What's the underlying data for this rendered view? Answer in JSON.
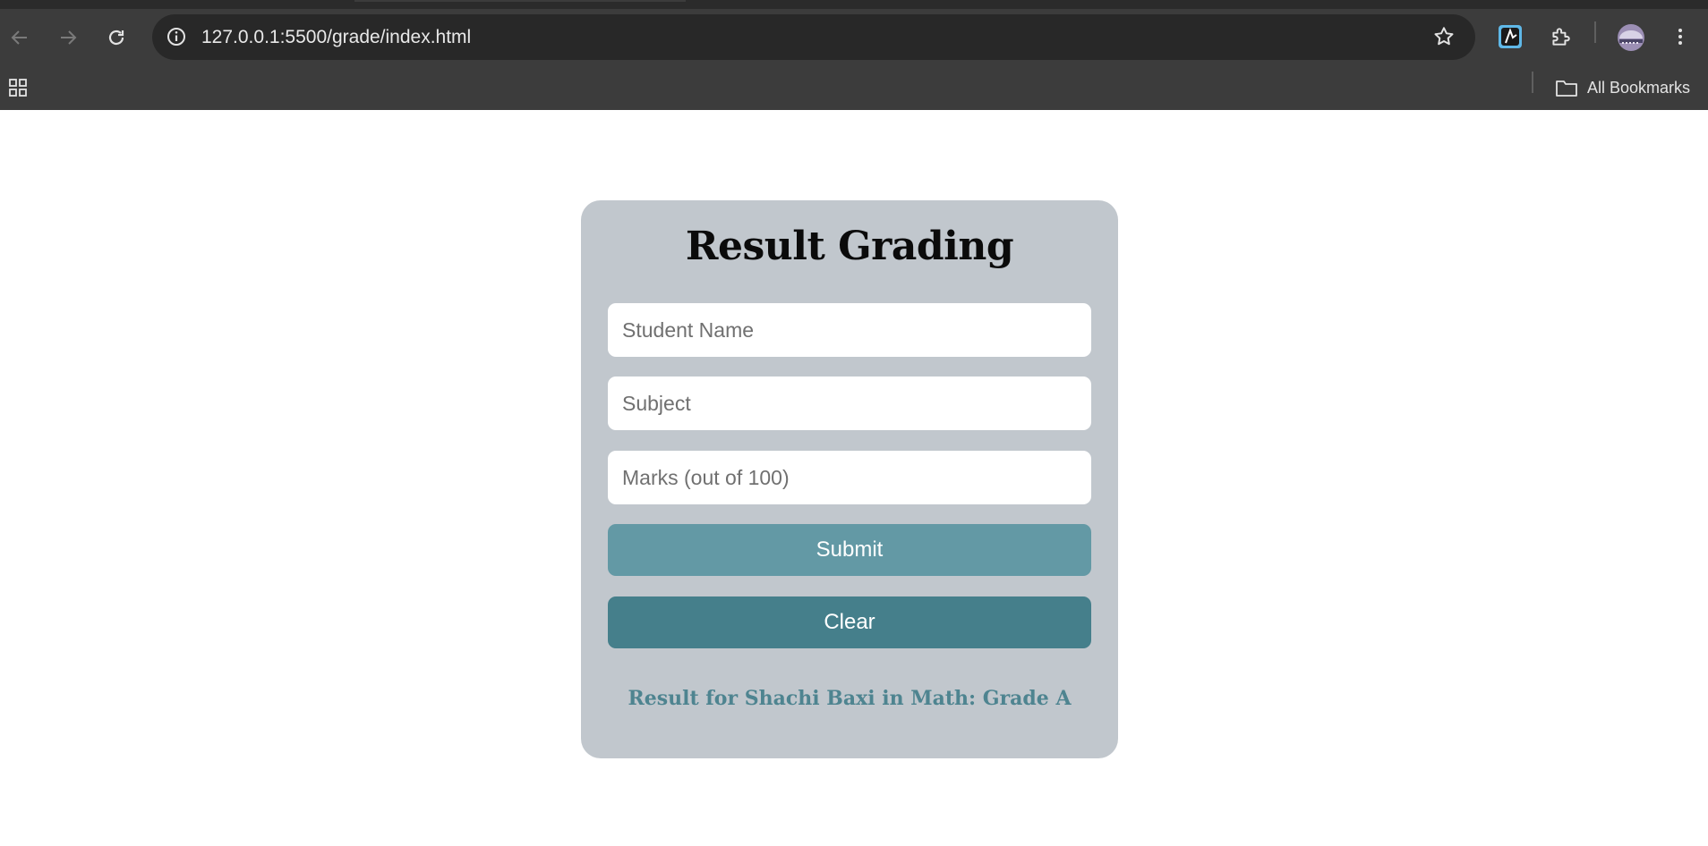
{
  "browser": {
    "url": "127.0.0.1:5500/grade/index.html",
    "bookmarks_label": "All Bookmarks",
    "chrome_color": "#3c3c3c"
  },
  "page": {
    "title": "Result Grading",
    "student_name_placeholder": "Student Name",
    "subject_placeholder": "Subject",
    "marks_placeholder": "Marks (out of 100)",
    "submit_label": "Submit",
    "clear_label": "Clear",
    "result_text": "Result for Shachi Baxi in Math: Grade A",
    "card_color": "#c1c7cd",
    "submit_color": "#6399a5",
    "clear_color": "#457f8b",
    "result_color": "#4e8490"
  }
}
